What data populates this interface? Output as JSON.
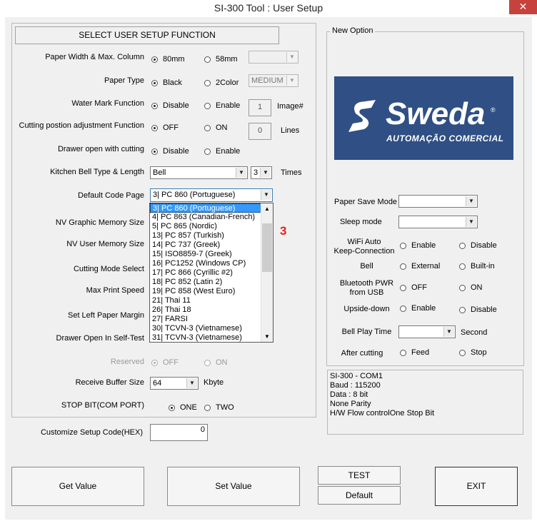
{
  "window": {
    "title": "SI-300 Tool : User Setup",
    "close_glyph": "✕"
  },
  "left": {
    "header": "SELECT USER SETUP FUNCTION",
    "paper_width": {
      "label": "Paper Width & Max. Column",
      "opt1": "80mm",
      "opt2": "58mm",
      "combo_value": ""
    },
    "paper_type": {
      "label": "Paper Type",
      "opt1": "Black",
      "opt2": "2Color",
      "combo_value": "MEDIUM"
    },
    "watermark": {
      "label": "Water Mark Function",
      "opt1": "Disable",
      "opt2": "Enable",
      "box_value": "1",
      "unit": "Image#"
    },
    "cutting_adj": {
      "label": "Cutting postion adjustment Function",
      "opt1": "OFF",
      "opt2": "ON",
      "box_value": "0",
      "unit": "Lines"
    },
    "drawer_cut": {
      "label": "Drawer open with cutting",
      "opt1": "Disable",
      "opt2": "Enable"
    },
    "kitchen_bell": {
      "label": "Kitchen Bell Type & Length",
      "type_value": "Bell",
      "length_value": "3",
      "unit": "Times"
    },
    "code_page": {
      "label": "Default Code Page",
      "value": "3| PC 860 (Portuguese)"
    },
    "nv_graphic": {
      "label": "NV Graphic Memory Size"
    },
    "nv_user": {
      "label": "NV User Memory Size"
    },
    "cutting_mode": {
      "label": "Cutting Mode Select"
    },
    "max_print_speed": {
      "label": "Max Print Speed"
    },
    "left_margin": {
      "label": "Set Left Paper Margin"
    },
    "drawer_selftest": {
      "label": "Drawer Open In Self-Test"
    },
    "reserved": {
      "label": "Reserved",
      "opt1": "OFF",
      "opt2": "ON"
    },
    "receive_buffer": {
      "label": "Receive Buffer Size",
      "value": "64",
      "unit": "Kbyte"
    },
    "stop_bit": {
      "label": "STOP BIT(COM PORT)",
      "opt1": "ONE",
      "opt2": "TWO"
    }
  },
  "code_page_list": [
    "3| PC 860 (Portuguese)",
    "4| PC 863 (Canadian-French)",
    "5| PC 865 (Nordic)",
    "13| PC 857 (Turkish)",
    "14| PC 737 (Greek)",
    "15| ISO8859-7 (Greek)",
    "16| PC1252 (Windows CP)",
    "17| PC 866 (Cyrillic #2)",
    "18| PC 852 (Latin 2)",
    "19| PC 858 (West Euro)",
    "21| Thai 11",
    "26| Thai 18",
    "27| FARSI",
    "30| TCVN-3 (Vietnamese)",
    "31| TCVN-3 (Vietnamese)"
  ],
  "annotation": "3",
  "custom_code": {
    "label": "Customize Setup Code(HEX)",
    "value": "0"
  },
  "right": {
    "group_title": "New Option",
    "logo_main": "Sweda",
    "logo_sub": "AUTOMAÇÃO COMERCIAL",
    "logo_reg": "®",
    "paper_save": {
      "label": "Paper Save Mode",
      "value": ""
    },
    "sleep": {
      "label": "Sleep mode",
      "value": ""
    },
    "wifi": {
      "label_l1": "WiFi Auto",
      "label_l2": "Keep-Connection",
      "opt1": "Enable",
      "opt2": "Disable"
    },
    "bell": {
      "label": "Bell",
      "opt1": "External",
      "opt2": "Built-in"
    },
    "bt_pwr": {
      "label_l1": "Bluetooth PWR",
      "label_l2": "from USB",
      "opt1": "OFF",
      "opt2": "ON"
    },
    "upside": {
      "label": "Upside-down",
      "opt1": "Enable",
      "opt2": "Disable"
    },
    "bell_time": {
      "label": "Bell Play Time",
      "value": "",
      "unit": "Second"
    },
    "after_cut": {
      "label": "After cutting",
      "opt1": "Feed",
      "opt2": "Stop"
    }
  },
  "status_info": [
    "SI-300 - COM1",
    "Baud : 115200",
    "Data : 8 bit",
    "None Parity",
    "H/W Flow controlOne Stop Bit"
  ],
  "buttons": {
    "get": "Get Value",
    "set": "Set Value",
    "test": "TEST",
    "default": "Default",
    "exit": "EXIT"
  },
  "colors": {
    "accent_selection": "#3399ff",
    "annotation_red": "#e0201b",
    "logo_bg": "#2f4f85",
    "close_red": "#c7423c"
  }
}
